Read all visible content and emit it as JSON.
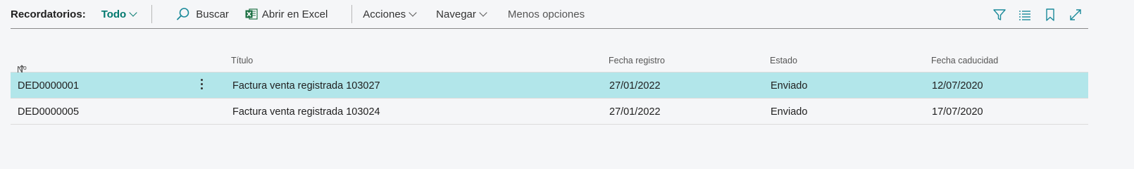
{
  "toolbar": {
    "title": "Recordatorios:",
    "view_label": "Todo",
    "search_label": "Buscar",
    "excel_label": "Abrir en Excel",
    "actions_label": "Acciones",
    "navigate_label": "Navegar",
    "less_options_label": "Menos opciones",
    "icons": [
      "filter-icon",
      "list-icon",
      "bookmark-icon",
      "expand-icon"
    ]
  },
  "table": {
    "columns": [
      {
        "label": "Nº",
        "sort": "ascending"
      },
      {
        "label": "Título"
      },
      {
        "label": "Fecha registro"
      },
      {
        "label": "Estado"
      },
      {
        "label": "Fecha caducidad"
      }
    ],
    "rows": [
      {
        "no": "DED0000001",
        "title": "Factura venta registrada 103027",
        "posting_date": "27/01/2022",
        "status": "Enviado",
        "due_date": "12/07/2020",
        "selected": true
      },
      {
        "no": "DED0000005",
        "title": "Factura venta registrada 103024",
        "posting_date": "27/01/2022",
        "status": "Enviado",
        "due_date": "17/07/2020",
        "selected": false
      }
    ]
  },
  "colors": {
    "accent": "#00786e",
    "selected_row": "#b2e6ea",
    "icon": "#1b8a9a",
    "excel_green": "#1e7145"
  }
}
